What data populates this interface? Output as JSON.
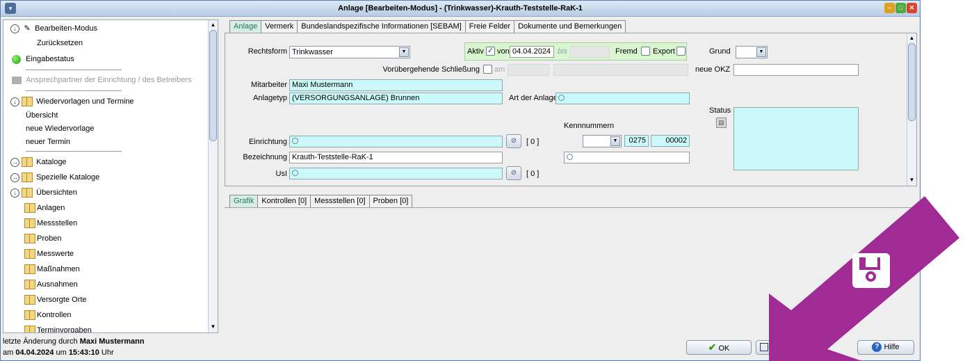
{
  "window": {
    "title": "Anlage [Bearbeiten-Modus] - (Trinkwasser)-Krauth-Teststelle-RaK-1"
  },
  "sidebar": {
    "edit_mode": "Bearbeiten-Modus",
    "reset": "Zurücksetzen",
    "input_status": "Eingabestatus",
    "contact": "Ansprechpartner der Einrichtung / des Betreibers",
    "resubmissions": "Wiedervorlagen und Termine",
    "overview": "Übersicht",
    "new_resubmission": "neue Wiedervorlage",
    "new_appointment": "neuer Termin",
    "catalogs": "Kataloge",
    "special_catalogs": "Spezielle Kataloge",
    "overviews": "Übersichten",
    "items": [
      "Anlagen",
      "Messstellen",
      "Proben",
      "Messwerte",
      "Maßnahmen",
      "Ausnahmen",
      "Versorgte Orte",
      "Kontrollen",
      "Terminvorgaben"
    ]
  },
  "status": {
    "line1_prefix": "letzte Änderung durch ",
    "user": "Maxi Mustermann",
    "line2_prefix": "am ",
    "date": "04.04.2024",
    "mid": " um ",
    "time": "15:43:10",
    "suffix": " Uhr"
  },
  "tabs_top": [
    "Anlage",
    "Vermerk",
    "Bundeslandspezifische Informationen [SEBAM]",
    "Freie Felder",
    "Dokumente und Bemerkungen"
  ],
  "tabs_bottom": [
    "Grafik",
    "Kontrollen [0]",
    "Messstellen [0]",
    "Proben [0]"
  ],
  "form": {
    "rechtsform_label": "Rechtsform",
    "rechtsform_value": "Trinkwasser",
    "aktiv_label": "Aktiv",
    "von_label": "von",
    "von_value": "04.04.2024",
    "bis_placeholder": "bis",
    "fremd_label": "Fremd",
    "export_label": "Export",
    "grund_label": "Grund",
    "closure_label": "Vorübergehende Schließung",
    "am_label": "am",
    "neue_okz_label": "neue OKZ",
    "mitarbeiter_label": "Mitarbeiter",
    "mitarbeiter_value": "Maxi Mustermann",
    "anlagetyp_label": "Anlagetyp",
    "anlagetyp_value": "(VERSORGUNGSANLAGE) Brunnen",
    "art_label": "Art der Anlage",
    "status_label": "Status",
    "kennnummern_label": "Kennnummern",
    "kenn_1": "0275",
    "kenn_2": "00002",
    "einrichtung_label": "Einrichtung",
    "einrichtung_count": "[ 0 ]",
    "bezeichnung_label": "Bezeichnung",
    "bezeichnung_value": "Krauth-Teststelle-RaK-1",
    "usi_label": "UsI",
    "usi_count": "[ 0 ]"
  },
  "buttons": {
    "ok": "OK",
    "help": "Hilfe"
  },
  "colors": {
    "overlay_arrow": "#a12b95",
    "active_tab": "#1a7a5e",
    "input_cyan": "#ccfafa"
  }
}
